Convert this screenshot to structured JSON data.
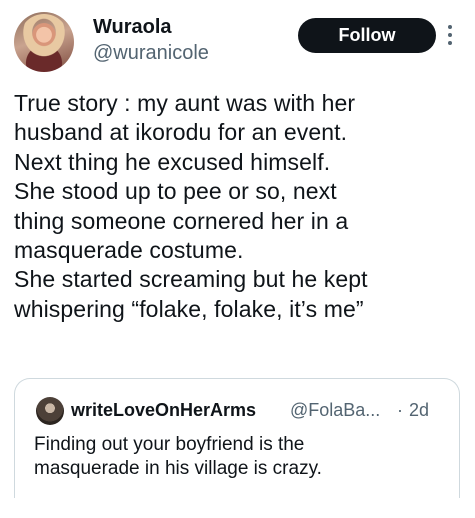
{
  "author": {
    "name": "Wuraola",
    "handle": "@wuranicole",
    "avatar_icon": "profile-photo"
  },
  "actions": {
    "follow_label": "Follow",
    "more_icon": "vertical-ellipsis-icon"
  },
  "tweet": {
    "lines": [
      "True story : my aunt was with her",
      "husband at ikorodu for an event.",
      "Next thing he excused himself.",
      "She stood up to pee or so, next",
      "thing someone cornered her in a",
      "masquerade costume.",
      "She started screaming but he kept",
      "whispering “folake, folake, it’s me”"
    ]
  },
  "quoted_tweet": {
    "name": "writeLoveOnHerArms",
    "handle": "@FolaBa...",
    "separator": "·",
    "time": "2d",
    "lines": [
      "Finding out your boyfriend is the",
      "masquerade in his village is crazy."
    ]
  },
  "colors": {
    "text_primary": "#0f1419",
    "text_secondary": "#536471",
    "button_bg": "#0f1419",
    "border": "#cfd9de"
  }
}
